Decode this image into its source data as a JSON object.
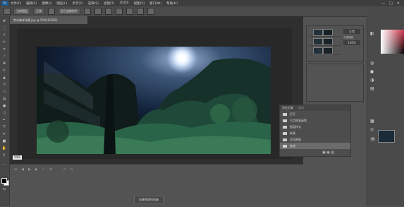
{
  "menubar": {
    "logo": "Ps",
    "items": [
      "文件(F)",
      "编辑(E)",
      "图像(I)",
      "图层(L)",
      "文字(Y)",
      "选择(S)",
      "滤镜(T)",
      "3D(D)",
      "视图(V)",
      "窗口(W)",
      "帮助(H)"
    ],
    "window_buttons": [
      "—",
      "□",
      "✕"
    ]
  },
  "options": {
    "sample_label": "当前图层",
    "mode_value": "正常",
    "check_label": "显示变换控件"
  },
  "document": {
    "tab_title": "梦幻森林场景.jpg @ 50%(RGB/8)",
    "zoom": "50%"
  },
  "timeline": {
    "create_button": "创建视频时间轴"
  },
  "history_panel": {
    "tabs": [
      "历史记录",
      "动作"
    ],
    "items": [
      "打开",
      "污点修复画笔",
      "图层样式",
      "新建",
      "应用图像",
      "曲线"
    ],
    "selected_index": 5
  },
  "layers_panel": {
    "blend_mode": "正常",
    "opacity_label": "不透明度",
    "opacity": "100%"
  },
  "colors": {
    "workspace": "#535353",
    "accent": "#d6364e"
  }
}
